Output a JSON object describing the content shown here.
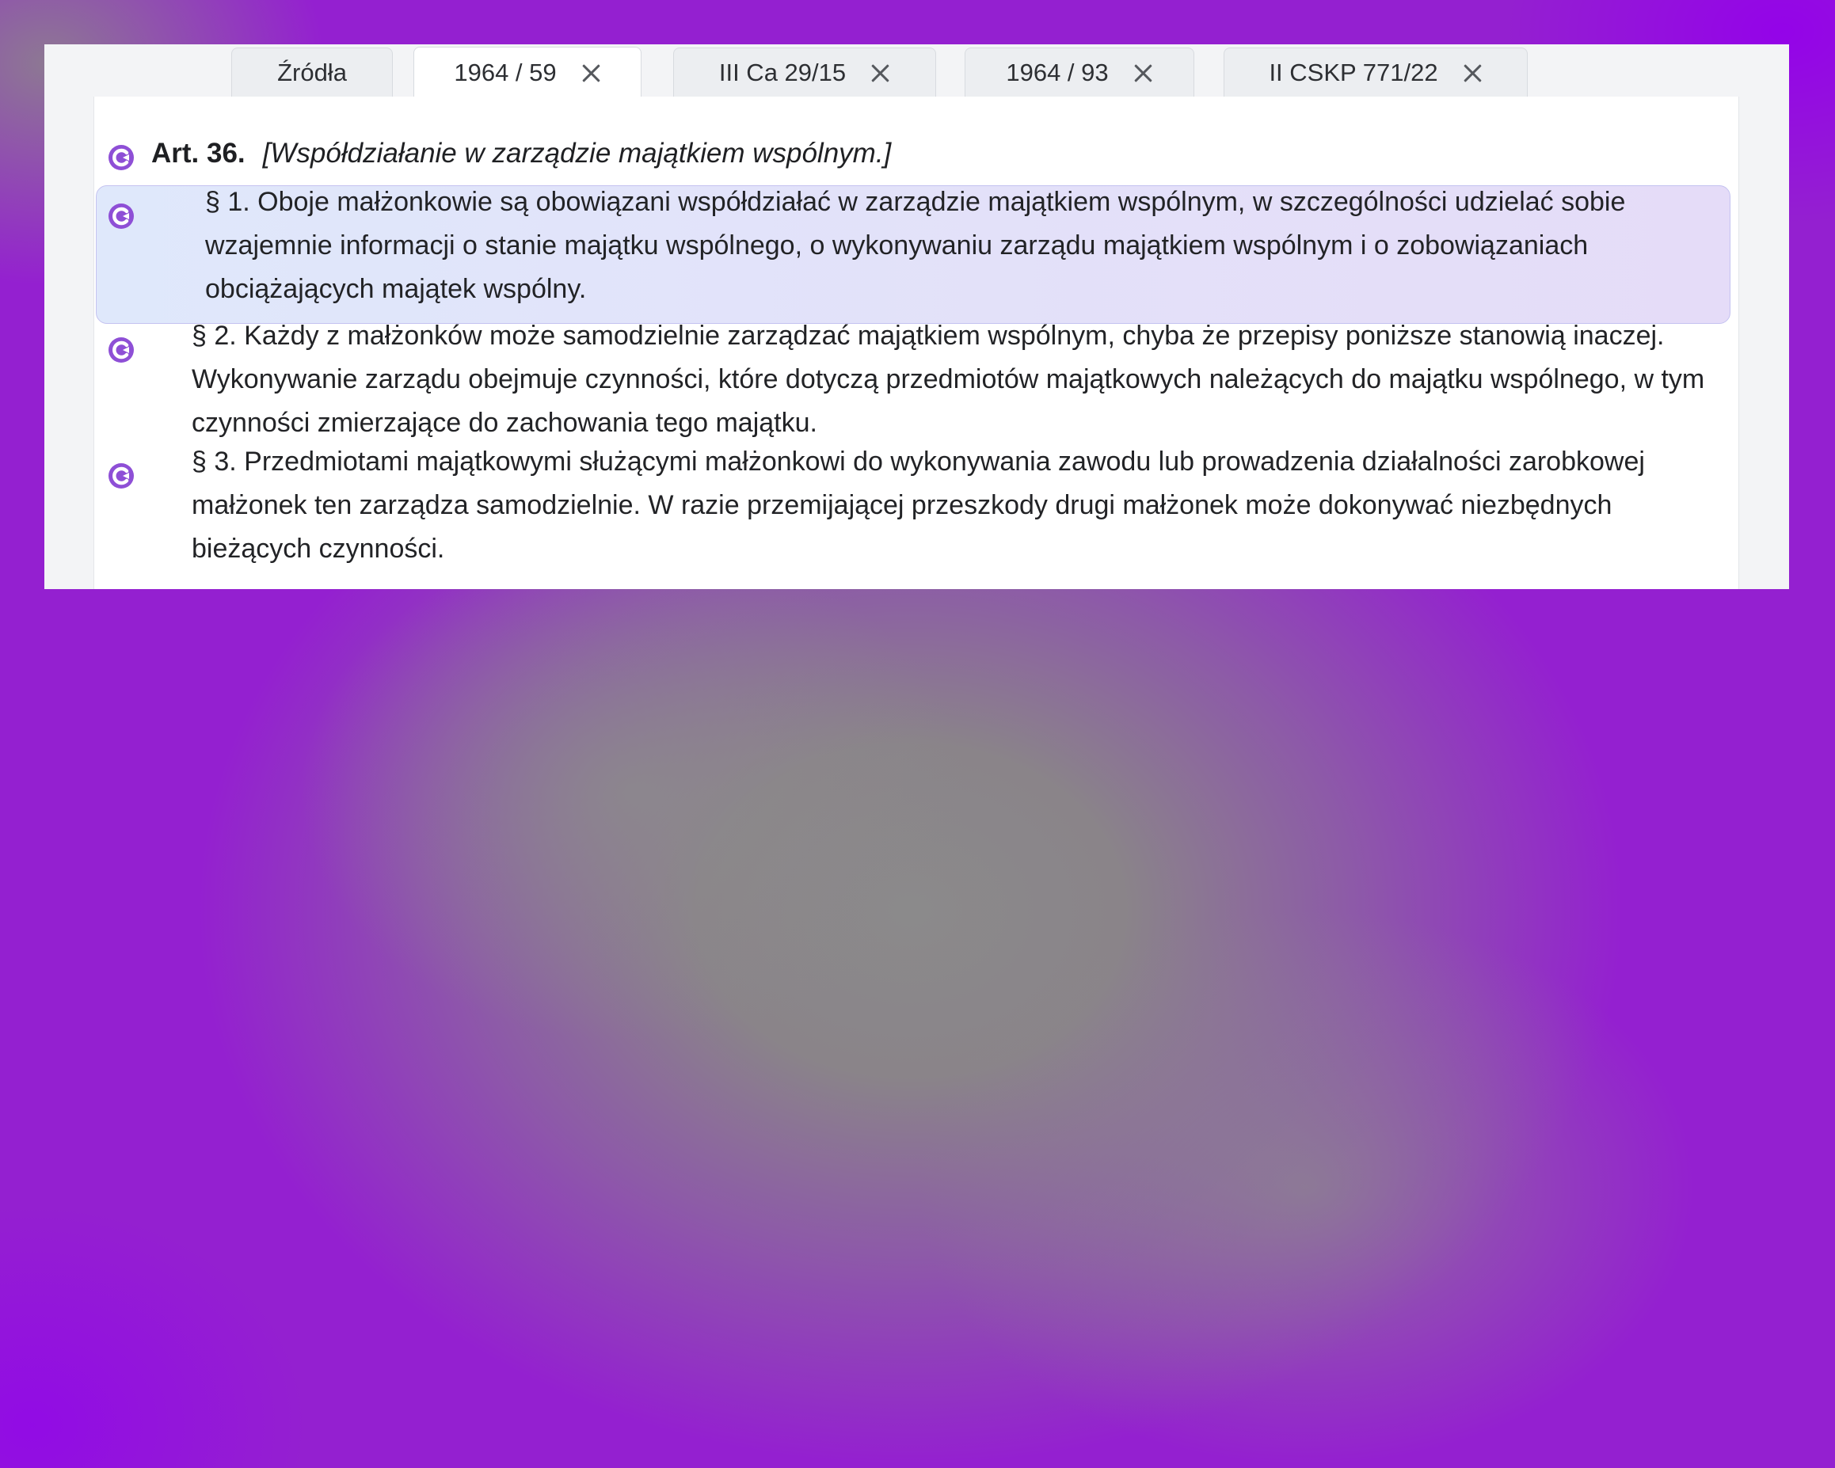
{
  "tabs": [
    {
      "label": "Źródła",
      "closable": false,
      "active": false
    },
    {
      "label": "1964 / 59",
      "closable": true,
      "active": true
    },
    {
      "label": "III Ca 29/15",
      "closable": true,
      "active": false
    },
    {
      "label": "1964 / 93",
      "closable": true,
      "active": false
    },
    {
      "label": "II CSKP 771/22",
      "closable": true,
      "active": false
    }
  ],
  "article": {
    "number": "Art. 36.",
    "title": "[Współdziałanie w zarządzie majątkiem wspólnym.]",
    "paragraphs": [
      {
        "text": "§ 1. Oboje małżonkowie są obowiązani współdziałać w zarządzie majątkiem wspólnym, w szczególności udzielać sobie wzajemnie informacji o stanie majątku wspólnego, o wykonywaniu zarządu majątkiem wspólnym i o zobowiązaniach obciążających majątek wspólny.",
        "highlighted": true
      },
      {
        "text": "§ 2. Każdy z małżonków może samodzielnie zarządzać majątkiem wspólnym, chyba że przepisy poniższe stanowią inaczej. Wykonywanie zarządu obejmuje czynności, które dotyczą przedmiotów majątkowych należących do majątku wspólnego, w tym czynności zmierzające do zachowania tego majątku.",
        "highlighted": false
      },
      {
        "text": "§ 3. Przedmiotami majątkowymi służącymi małżonkowi do wykonywania zawodu lub prowadzenia działalności zarobkowej małżonek ten zarządza samodzielnie. W razie przemijającej przeszkody drugi małżonek może dokonywać niezbędnych bieżących czynności.",
        "highlighted": false
      }
    ]
  },
  "icons": {
    "paragraph_link": "link-c-icon",
    "tab_close": "close-icon"
  },
  "colors": {
    "icon_accent": "#8e4fd6",
    "highlight_border": "#c4c2f0",
    "highlight_fill_start": "#dfe8fb",
    "highlight_fill_end": "#e5dcf8"
  }
}
